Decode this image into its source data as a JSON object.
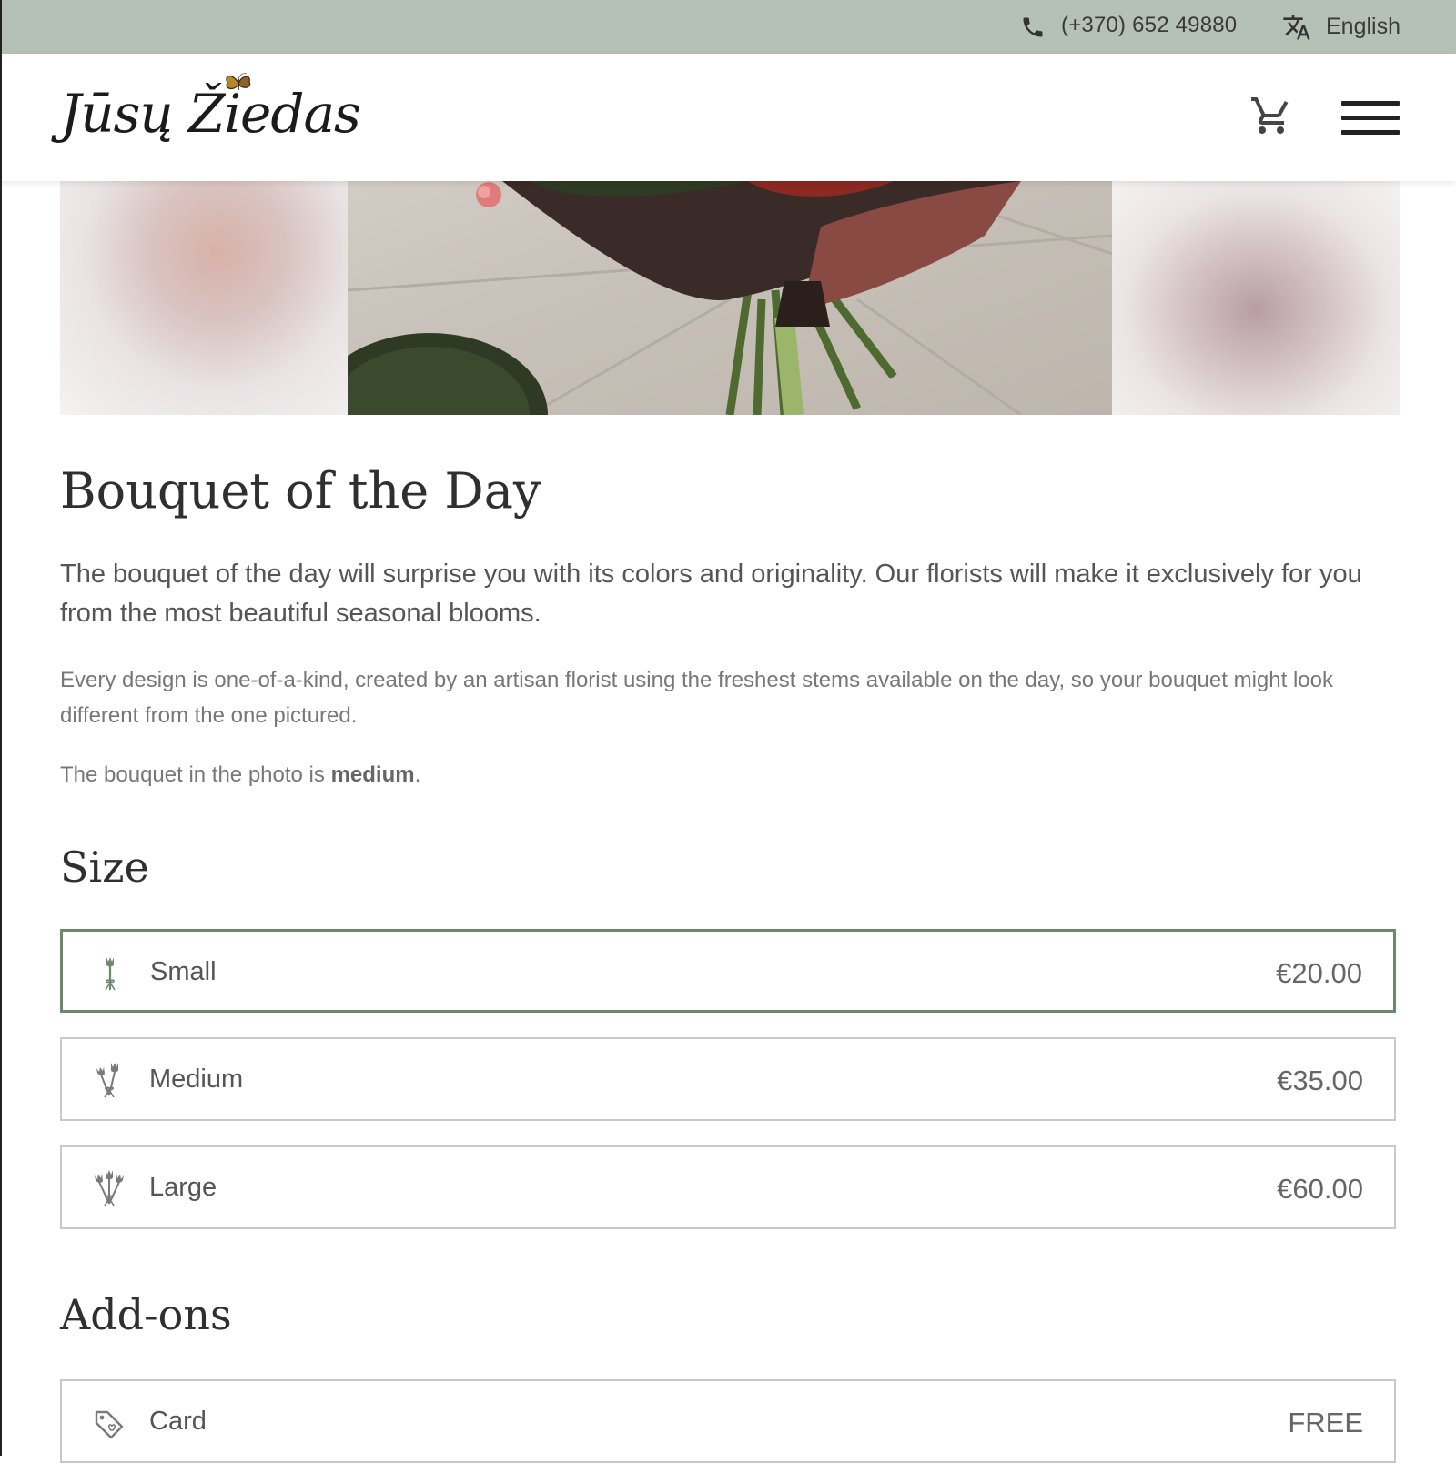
{
  "topbar": {
    "phone": "(+370) 652 49880",
    "language": "English"
  },
  "header": {
    "logo_text": "Jūsų Žiedas",
    "icons": [
      "shopping-cart-icon",
      "hamburger-menu-icon"
    ]
  },
  "product": {
    "title": "Bouquet of the Day",
    "lead": "The bouquet of the day will surprise you with its colors and originality. Our florists will make it exclusively for you from the most beautiful seasonal blooms.",
    "description": "Every design is one-of-a-kind, created by an artisan florist using the freshest stems available on the day, so your bouquet might look different from the one pictured.",
    "note_prefix": "The bouquet in the photo is ",
    "note_bold": "medium",
    "note_suffix": "."
  },
  "size": {
    "heading": "Size",
    "options": [
      {
        "label": "Small",
        "price": "€20.00",
        "selected": true
      },
      {
        "label": "Medium",
        "price": "€35.00",
        "selected": false
      },
      {
        "label": "Large",
        "price": "€60.00",
        "selected": false
      }
    ]
  },
  "addons": {
    "heading": "Add-ons",
    "options": [
      {
        "label": "Card",
        "price": "FREE"
      }
    ]
  },
  "colors": {
    "topbar_bg": "#b5c1b5",
    "accent_green": "#6b8a6b"
  }
}
